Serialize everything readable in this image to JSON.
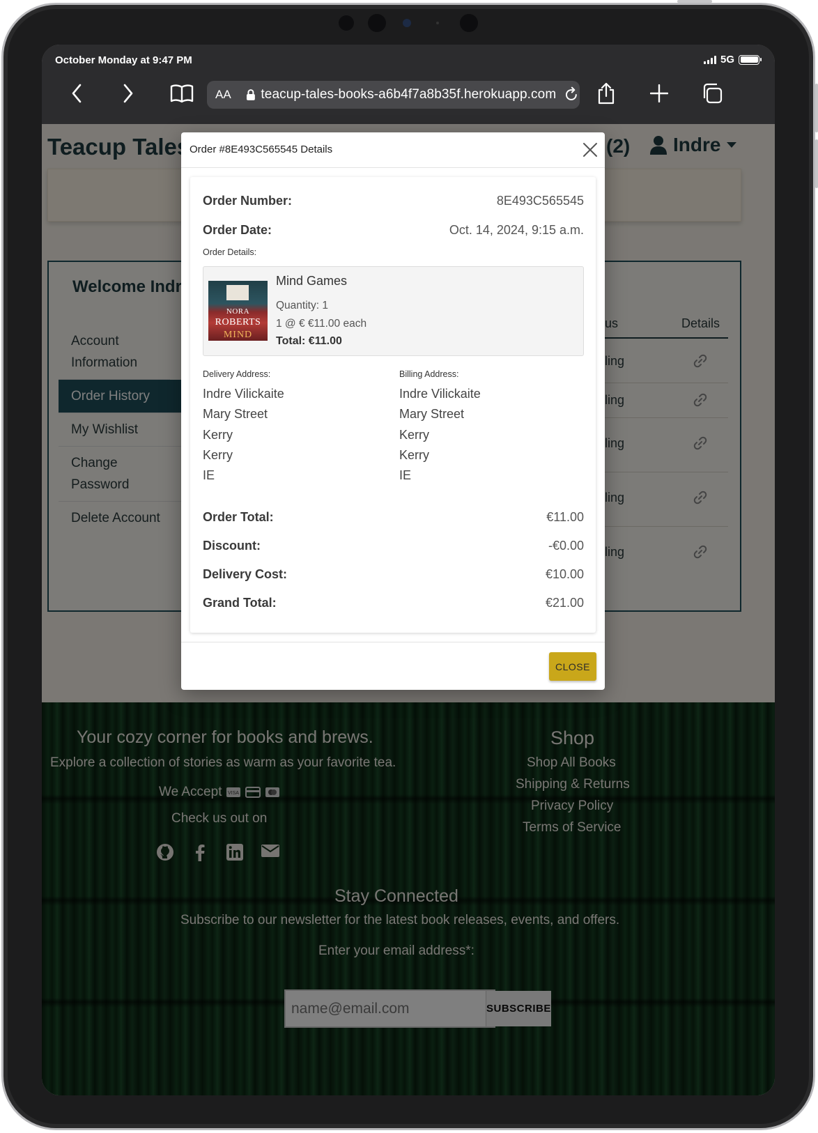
{
  "status_bar": {
    "time": "October Monday at 9:47 PM",
    "network": "5G"
  },
  "browser": {
    "text_size_label": "AA",
    "url": "teacup-tales-books-a6b4f7a8b35f.herokuapp.com"
  },
  "site": {
    "brand": "Teacup Tales B",
    "cart_count": "(2)",
    "user_name": "Indre"
  },
  "account": {
    "welcome": "Welcome Indre",
    "menu": [
      "Account Information",
      "Order History",
      "My Wishlist",
      "Change Password",
      "Delete Account"
    ],
    "active_menu": "Order History",
    "table_headers": {
      "status": "us",
      "details": "Details"
    },
    "rows_status_fragment": [
      "ling",
      "ling",
      "ling",
      "ling",
      "ling"
    ]
  },
  "modal": {
    "title": "Order #8E493C565545 Details",
    "order_number_label": "Order Number:",
    "order_number": "8E493C565545",
    "order_date_label": "Order Date:",
    "order_date": "Oct. 14, 2024, 9:15 a.m.",
    "order_details_label": "Order Details:",
    "item": {
      "title": "Mind Games",
      "quantity": "Quantity: 1",
      "price_line": "1 @ € €11.00 each",
      "total": "Total: €11.00",
      "cover": {
        "author_line1": "NORA",
        "author_line2": "ROBERTS",
        "title_word": "MIND"
      }
    },
    "delivery_address_label": "Delivery Address:",
    "delivery_address": [
      "Indre Vilickaite",
      "Mary Street",
      "Kerry",
      "Kerry",
      "IE"
    ],
    "billing_address_label": "Billing Address:",
    "billing_address": [
      "Indre Vilickaite",
      "Mary Street",
      "Kerry",
      "Kerry",
      "IE"
    ],
    "order_total_label": "Order Total:",
    "order_total": "€11.00",
    "discount_label": "Discount:",
    "discount": "-€0.00",
    "delivery_cost_label": "Delivery Cost:",
    "delivery_cost": "€10.00",
    "grand_total_label": "Grand Total:",
    "grand_total": "€21.00",
    "close_label": "CLOSE"
  },
  "footer": {
    "tagline": "Your cozy corner for books and brews.",
    "subtagline": "Explore a collection of stories as warm as your favorite tea.",
    "we_accept": "We Accept",
    "check_us_out": "Check us out on",
    "shop_heading": "Shop",
    "shop_links": [
      "Shop All Books",
      "Shipping & Returns",
      "Privacy Policy",
      "Terms of Service"
    ],
    "stay_connected": "Stay Connected",
    "newsletter_text": "Subscribe to our newsletter for the latest book releases, events, and offers.",
    "email_label": "Enter your email address*:",
    "email_placeholder": "name@email.com",
    "subscribe_label": "SUBSCRIBE"
  },
  "colors": {
    "accent_gold": "#c9a71a",
    "brand_teal": "#1f4f5a",
    "browser_chrome": "#2c2c2e"
  }
}
